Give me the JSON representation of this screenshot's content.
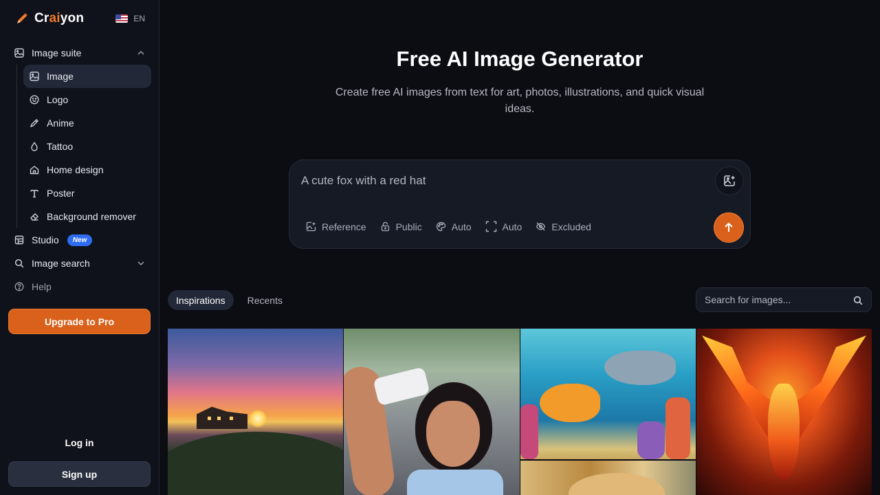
{
  "brand": {
    "name_prefix": "Cr",
    "name_ai": "ai",
    "name_suffix": "yon",
    "accent_color": "#d9611b"
  },
  "language": {
    "code": "EN",
    "flag": "us-flag-icon"
  },
  "sidebar": {
    "image_suite": {
      "label": "Image suite",
      "items": [
        {
          "label": "Image",
          "icon": "image-icon",
          "active": true
        },
        {
          "label": "Logo",
          "icon": "smiley-icon"
        },
        {
          "label": "Anime",
          "icon": "brush-icon"
        },
        {
          "label": "Tattoo",
          "icon": "drop-icon"
        },
        {
          "label": "Home design",
          "icon": "home-icon"
        },
        {
          "label": "Poster",
          "icon": "text-icon"
        },
        {
          "label": "Background remover",
          "icon": "eraser-icon"
        }
      ]
    },
    "studio": {
      "label": "Studio",
      "badge": "New"
    },
    "image_search": {
      "label": "Image search"
    },
    "help": {
      "label": "Help"
    },
    "upgrade_label": "Upgrade to Pro",
    "login_label": "Log in",
    "signup_label": "Sign up"
  },
  "main": {
    "title": "Free AI Image Generator",
    "subtitle": "Create free AI images from text for art, photos, illustrations, and quick visual ideas.",
    "prompt": {
      "placeholder": "A cute fox with a red hat",
      "options": [
        {
          "label": "Reference",
          "icon": "image-plus-icon"
        },
        {
          "label": "Public",
          "icon": "lock-icon"
        },
        {
          "label": "Auto",
          "icon": "palette-icon"
        },
        {
          "label": "Auto",
          "icon": "aspect-ratio-icon"
        },
        {
          "label": "Excluded",
          "icon": "eye-off-icon"
        }
      ]
    },
    "tabs": [
      {
        "label": "Inspirations",
        "active": true
      },
      {
        "label": "Recents",
        "active": false
      }
    ],
    "search_placeholder": "Search for images..."
  }
}
